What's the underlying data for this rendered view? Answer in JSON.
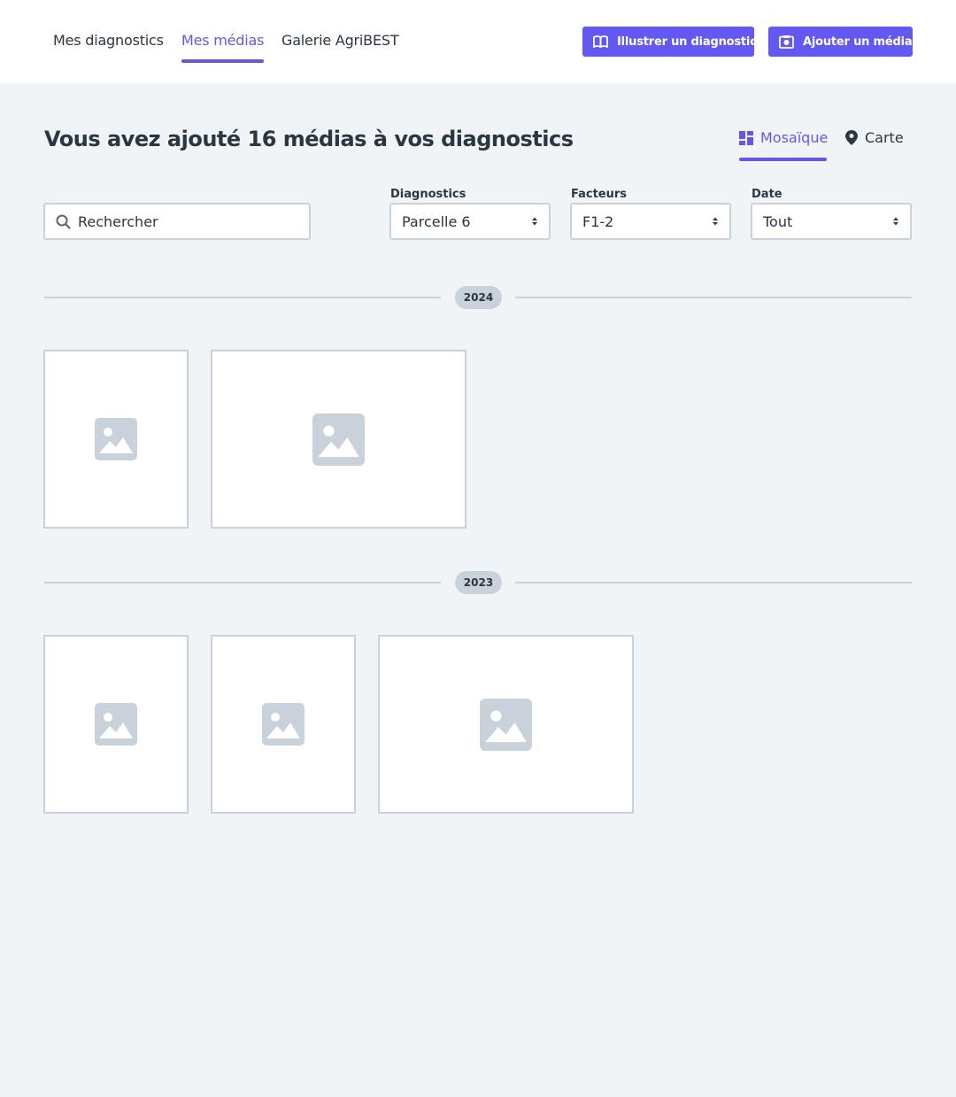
{
  "nav": {
    "tabs": [
      {
        "label": "Mes diagnostics"
      },
      {
        "label": "Mes médias"
      },
      {
        "label": "Galerie AgriBEST"
      }
    ],
    "active_tab": "Mes médias"
  },
  "actions": {
    "illustrate_label": "Illustrer un diagnostic",
    "add_media_label": "Ajouter un média"
  },
  "header": {
    "title": "Vous avez ajouté 16 médias à vos diagnostics"
  },
  "view_switch": {
    "mosaic_label": "Mosaïque",
    "map_label": "Carte",
    "active": "Mosaïque"
  },
  "filters": {
    "search_placeholder": "Rechercher",
    "diagnostics": {
      "label": "Diagnostics",
      "value": "Parcelle 6"
    },
    "facteurs": {
      "label": "Facteurs",
      "value": "F1-2"
    },
    "date": {
      "label": "Date",
      "value": "Tout"
    }
  },
  "groups": [
    {
      "year": "2024",
      "media": [
        "image-placeholder-icon",
        "image-placeholder-icon"
      ]
    },
    {
      "year": "2023",
      "media": [
        "image-placeholder-icon",
        "image-placeholder-icon",
        "image-placeholder-icon"
      ]
    }
  ],
  "colors": {
    "accent": "#6756e6",
    "button": "#6458f2",
    "background": "#f0f4f7",
    "border": "#c9d2da",
    "text": "#2b3641"
  }
}
